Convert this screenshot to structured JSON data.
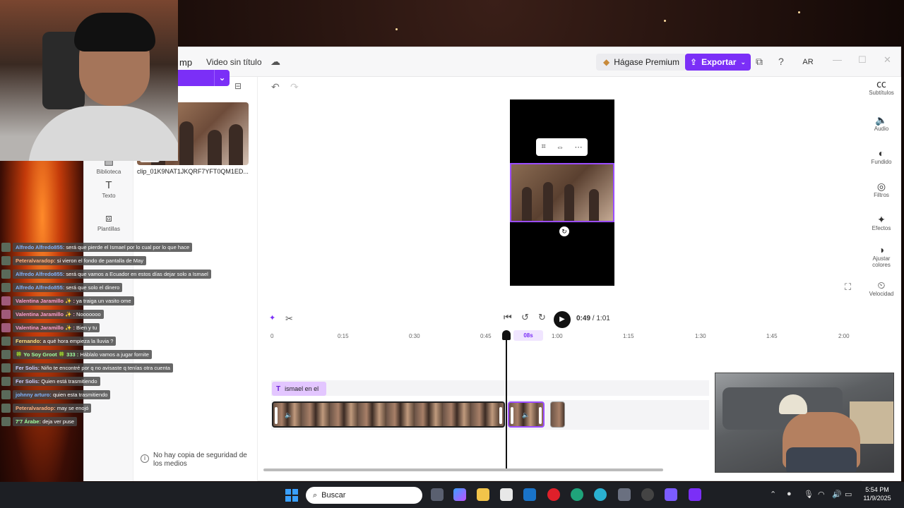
{
  "app": {
    "name_partial": "mp",
    "video_title": "Video sin título",
    "premium_label": "Hágase Premium",
    "export_label": "Exportar",
    "avatar_initials": "AR",
    "accent_color": "#7b2ff7"
  },
  "left_rail": {
    "items": [
      {
        "label": "Biblioteca",
        "icon": "library-icon"
      },
      {
        "label": "Texto",
        "icon": "text-icon"
      },
      {
        "label": "Plantillas",
        "icon": "templates-icon"
      }
    ]
  },
  "media_panel": {
    "import_label": "ar medios",
    "clip": {
      "duration": "1:01",
      "name": "clip_01K9NAT1JKQRF7YFT0QM1ED..."
    },
    "backup_note": "No hay copia de seguridad de los medios"
  },
  "right_rail": {
    "items": [
      {
        "label": "Subtítulos",
        "icon": "captions-icon"
      },
      {
        "label": "Audio",
        "icon": "audio-icon"
      },
      {
        "label": "Fundido",
        "icon": "fade-icon"
      },
      {
        "label": "Filtros",
        "icon": "filters-icon"
      },
      {
        "label": "Efectos",
        "icon": "effects-icon"
      },
      {
        "label": "Ajustar colores",
        "icon": "adjust-colors-icon"
      },
      {
        "label": "Velocidad",
        "icon": "speed-icon"
      }
    ]
  },
  "playback": {
    "current_time": "0:49",
    "separator": "/",
    "total_time": "1:01"
  },
  "timeline": {
    "ruler_ticks": [
      "0",
      "0:15",
      "0:30",
      "0:45",
      "1:00",
      "1:15",
      "1:30",
      "1:45",
      "2:00"
    ],
    "playhead_label": "08s",
    "text_clip_label": "ismael en el"
  },
  "chat": [
    {
      "user": "Alfredo Alfredo855:",
      "msg": "será que pierde el Ismael por lo cual por lo que hace"
    },
    {
      "user": "Peteralvaradop:",
      "msg": "si vieron el fondo de pantalla de May"
    },
    {
      "user": "Alfredo Alfredo855:",
      "msg": "será que vamos a Ecuador en estos días dejar solo a Ismael"
    },
    {
      "user": "Alfredo Alfredo855:",
      "msg": "será que solo el dinero"
    },
    {
      "user": "Valentina Jaramillo ✨ :",
      "msg": "ya traiga un vasito ome"
    },
    {
      "user": "Valentina Jaramillo ✨ :",
      "msg": "Nooooooo"
    },
    {
      "user": "Valentina Jaramillo ✨ :",
      "msg": "Bien y tu"
    },
    {
      "user": "Fernando:",
      "msg": "a qué hora empieza la lluvia ?"
    },
    {
      "user": "🍀 Yo Soy Groot 🍀 333 :",
      "msg": "Háblalo vamos a jugar fornite"
    },
    {
      "user": "Fer Solis:",
      "msg": "Niño te encontré por q no avisaste q tenías otra cuenta"
    },
    {
      "user": "Fer Solis:",
      "msg": "Quien está trasmitiendo"
    },
    {
      "user": "johnny arturo:",
      "msg": "quien esta trasmitiendo"
    },
    {
      "user": "Peteralvaradop:",
      "msg": "may se enojó"
    },
    {
      "user": "7'7 Árabe:",
      "msg": "deja ver puse"
    }
  ],
  "taskbar": {
    "search_placeholder": "Buscar",
    "time": "5:54 PM",
    "date": "11/9/2025"
  }
}
